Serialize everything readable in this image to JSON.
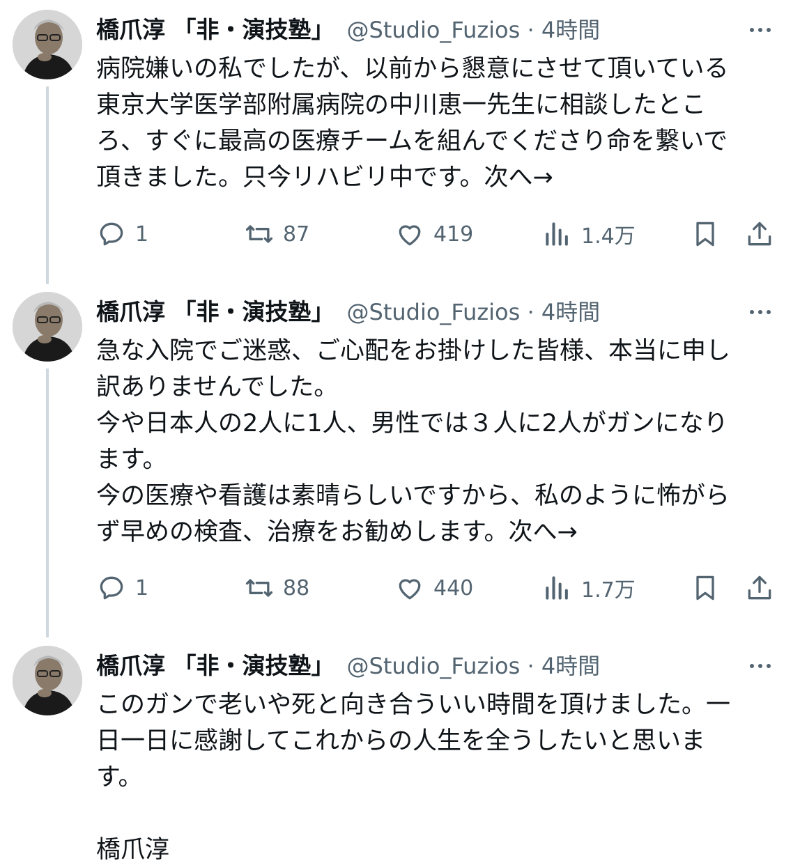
{
  "tweets": [
    {
      "name": "橋爪淳 「非・演技塾」",
      "handle_time": "@Studio_Fuzios · 4時間",
      "text": "病院嫌いの私でしたが、以前から懇意にさせて頂いている\n東京大学医学部附属病院の中川恵一先生に相談したとこ\nろ、すぐに最高の医療チームを組んでくださり命を繋いで\n頂きました。只今リハビリ中です。次へ→",
      "reply": "1",
      "retweet": "87",
      "like": "419",
      "views": "1.4万"
    },
    {
      "name": "橋爪淳 「非・演技塾」",
      "handle_time": "@Studio_Fuzios · 4時間",
      "text": "急な入院でご迷惑、ご心配をお掛けした皆様、本当に申し\n訳ありませんでした。\n今や日本人の2人に1人、男性では３人に2人がガンになり\nます。\n今の医療や看護は素晴らしいですから、私のように怖がら\nず早めの検査、治療をお勧めします。次へ→",
      "reply": "1",
      "retweet": "88",
      "like": "440",
      "views": "1.7万"
    },
    {
      "name": "橋爪淳 「非・演技塾」",
      "handle_time": "@Studio_Fuzios · 4時間",
      "text": "このガンで老いや死と向き合ういい時間を頂けました。一\n日一日に感謝してこれからの人生を全うしたいと思いま\nす。\n\n橋爪淳"
    }
  ],
  "icons": [
    "reply-icon",
    "retweet-icon",
    "like-icon",
    "views-icon",
    "bookmark-icon",
    "share-icon",
    "more-icon"
  ],
  "colors": {
    "text": "#0f1419",
    "secondary": "#536471",
    "thread_line": "#cfd9de"
  }
}
